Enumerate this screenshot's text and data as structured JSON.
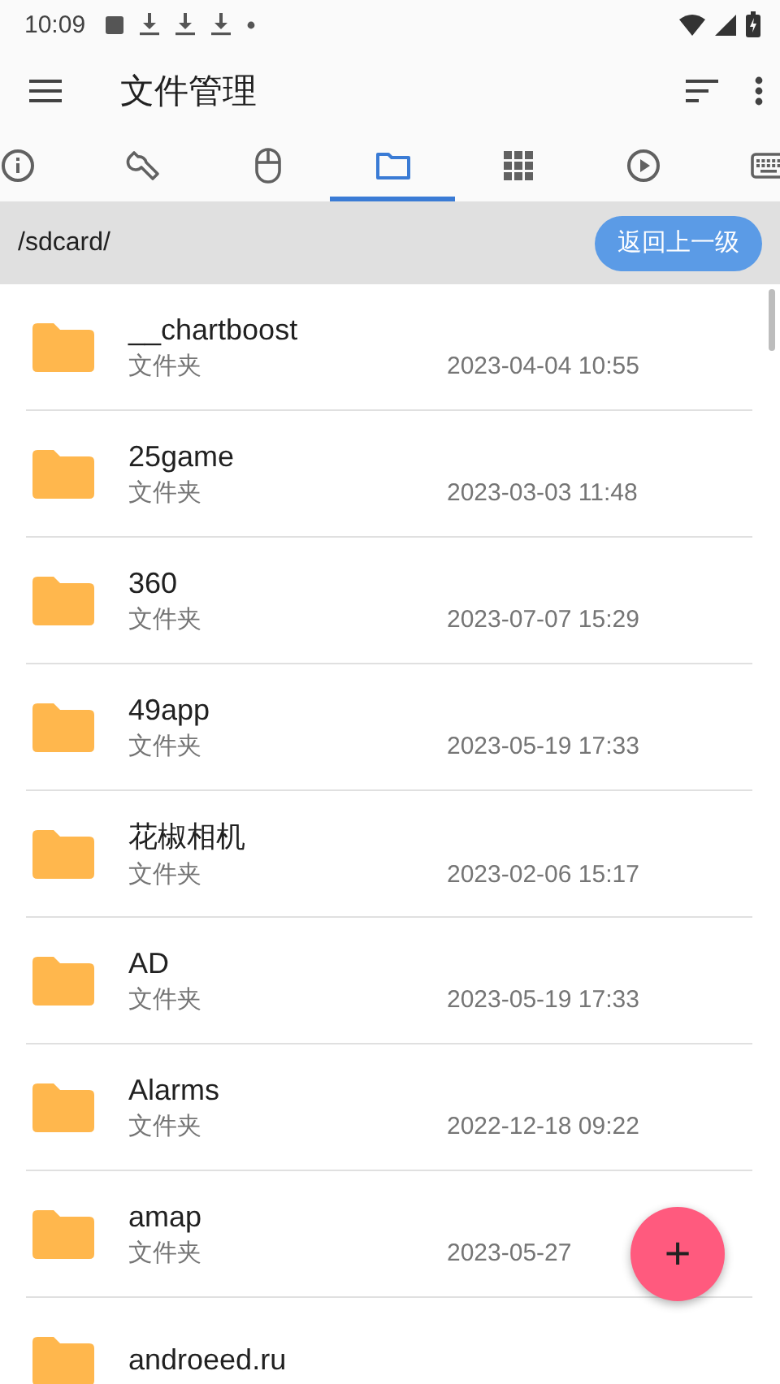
{
  "status_bar": {
    "time": "10:09"
  },
  "app_bar": {
    "title": "文件管理"
  },
  "tabs": [
    {
      "kind": "info",
      "selected": false
    },
    {
      "kind": "wrench",
      "selected": false
    },
    {
      "kind": "mouse",
      "selected": false
    },
    {
      "kind": "folder",
      "selected": true
    },
    {
      "kind": "grid",
      "selected": false
    },
    {
      "kind": "play",
      "selected": false
    },
    {
      "kind": "keyboard",
      "selected": false
    }
  ],
  "path_bar": {
    "path": "/sdcard/",
    "button": "返回上一级"
  },
  "files": [
    {
      "name": "__chartboost",
      "type": "文件夹",
      "date": "2023-04-04 10:55"
    },
    {
      "name": "25game",
      "type": "文件夹",
      "date": "2023-03-03 11:48"
    },
    {
      "name": "360",
      "type": "文件夹",
      "date": "2023-07-07 15:29"
    },
    {
      "name": "49app",
      "type": "文件夹",
      "date": "2023-05-19 17:33"
    },
    {
      "name": "花椒相机",
      "type": "文件夹",
      "date": "2023-02-06 15:17"
    },
    {
      "name": "AD",
      "type": "文件夹",
      "date": "2023-05-19 17:33"
    },
    {
      "name": "Alarms",
      "type": "文件夹",
      "date": "2022-12-18 09:22"
    },
    {
      "name": "amap",
      "type": "文件夹",
      "date": "2023-05-27"
    },
    {
      "name": "androeed.ru"
    }
  ],
  "fab": {
    "label": "+"
  }
}
